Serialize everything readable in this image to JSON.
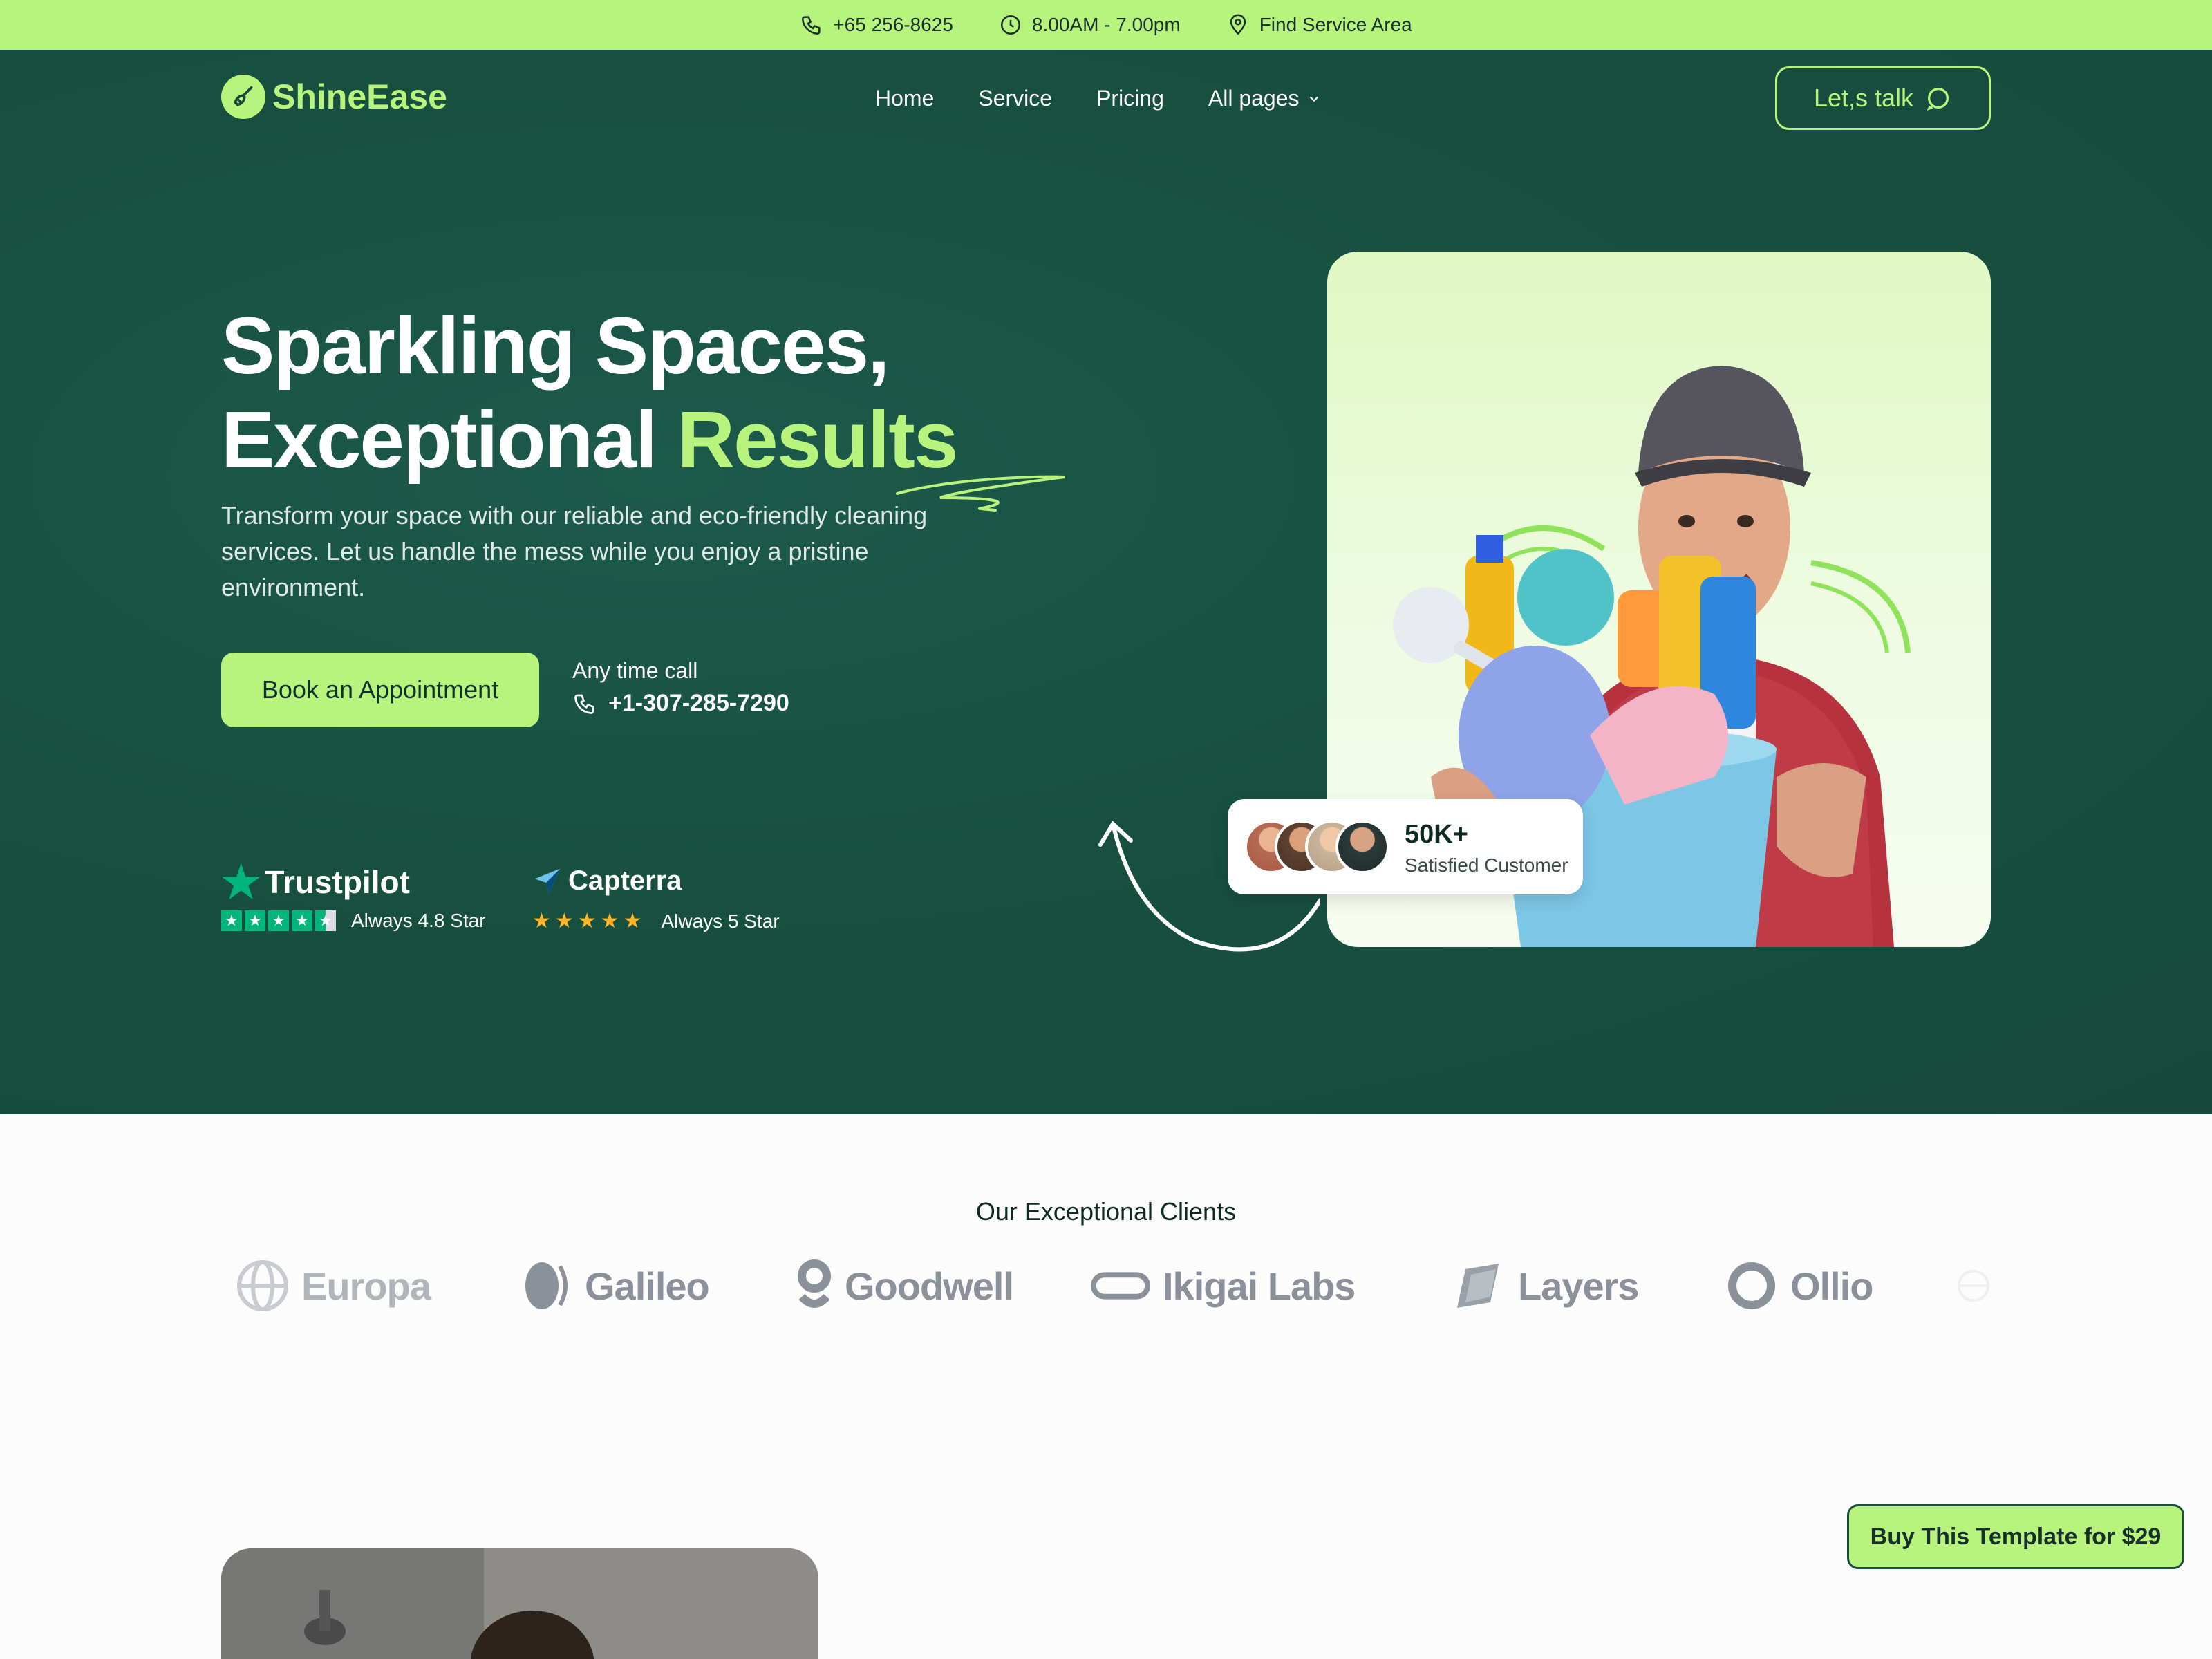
{
  "topbar": {
    "phone": "+65 256-8625",
    "hours": "8.00AM - 7.00pm",
    "area": "Find Service Area"
  },
  "brand": {
    "name": "ShineEase"
  },
  "nav": {
    "items": [
      "Home",
      "Service",
      "Pricing",
      "All pages"
    ],
    "cta": "Let,s talk"
  },
  "hero": {
    "title_line1": "Sparkling Spaces,",
    "title_line2_a": "Exceptional",
    "title_line2_b": "Results",
    "lead": "Transform your space with our reliable and eco-friendly cleaning services. Let us handle the mess while you enjoy a pristine environment.",
    "book_label": "Book an Appointment",
    "call_label": "Any time call",
    "call_number": "+1-307-285-7290"
  },
  "ratings": {
    "trustpilot_name": "Trustpilot",
    "trustpilot_text": "Always 4.8 Star",
    "capterra_name": "Capterra",
    "capterra_text": "Always 5 Star"
  },
  "stat": {
    "value": "50K+",
    "label": "Satisfied Customer"
  },
  "clients": {
    "title": "Our Exceptional Clients",
    "logos": [
      "Europa",
      "Galileo",
      "Goodwell",
      "Ikigai Labs",
      "Layers",
      "Ollio"
    ]
  },
  "buy": {
    "label": "Buy This Template for $29"
  },
  "colors": {
    "accent": "#b8f47d",
    "hero_bg": "#17503f",
    "logo_gray": "#8b919a"
  }
}
